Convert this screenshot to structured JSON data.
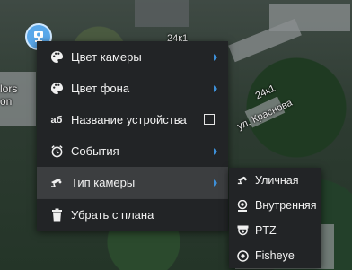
{
  "map": {
    "labels": {
      "road_24k1_top": "24к1",
      "road_24k1_mid": "24к1",
      "street": "ул. Краснова",
      "left_fragment_1": "lors",
      "left_fragment_2": "on"
    }
  },
  "context_menu": {
    "items": [
      {
        "label": "Цвет камеры",
        "icon": "palette-icon",
        "has_submenu": true
      },
      {
        "label": "Цвет фона",
        "icon": "palette-icon",
        "has_submenu": true
      },
      {
        "label": "Название устройства",
        "icon": "text-ab-icon",
        "checkbox": true,
        "checked": false
      },
      {
        "label": "События",
        "icon": "alarm-clock-icon",
        "has_submenu": true
      },
      {
        "label": "Тип камеры",
        "icon": "camera-icon",
        "has_submenu": true,
        "active": true
      },
      {
        "label": "Убрать с плана",
        "icon": "trash-icon",
        "has_submenu": false
      }
    ]
  },
  "camera_type_submenu": {
    "items": [
      {
        "label": "Уличная",
        "icon": "outdoor-camera-icon"
      },
      {
        "label": "Внутренняя",
        "icon": "indoor-camera-icon"
      },
      {
        "label": "PTZ",
        "icon": "ptz-camera-icon"
      },
      {
        "label": "Fisheye",
        "icon": "fisheye-camera-icon"
      }
    ]
  },
  "colors": {
    "menu_bg": "#222426",
    "menu_active_bg": "#3c3e40",
    "submenu_arrow": "#3d8fd8",
    "camera_pin": "#5aa8ea"
  }
}
